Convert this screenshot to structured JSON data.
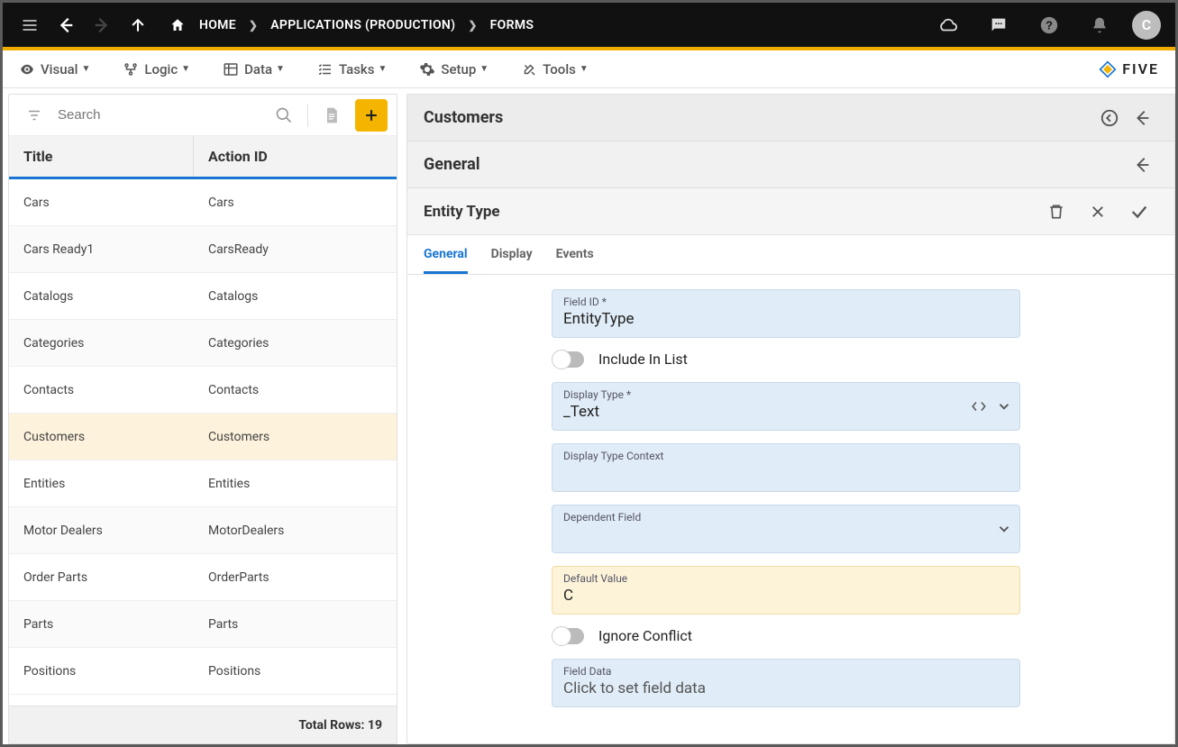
{
  "breadcrumb": {
    "home": "HOME",
    "apps": "APPLICATIONS (PRODUCTION)",
    "forms": "FORMS"
  },
  "avatar_letter": "C",
  "menubar": [
    {
      "id": "visual",
      "label": "Visual"
    },
    {
      "id": "logic",
      "label": "Logic"
    },
    {
      "id": "data",
      "label": "Data"
    },
    {
      "id": "tasks",
      "label": "Tasks"
    },
    {
      "id": "setup",
      "label": "Setup"
    },
    {
      "id": "tools",
      "label": "Tools"
    }
  ],
  "brand": "FIVE",
  "left": {
    "search_placeholder": "Search",
    "columns": {
      "title": "Title",
      "action": "Action ID"
    },
    "rows": [
      {
        "title": "Cars",
        "action": "Cars",
        "selected": false
      },
      {
        "title": "Cars Ready1",
        "action": "CarsReady",
        "selected": false
      },
      {
        "title": "Catalogs",
        "action": "Catalogs",
        "selected": false
      },
      {
        "title": "Categories",
        "action": "Categories",
        "selected": false
      },
      {
        "title": "Contacts",
        "action": "Contacts",
        "selected": false
      },
      {
        "title": "Customers",
        "action": "Customers",
        "selected": true
      },
      {
        "title": "Entities",
        "action": "Entities",
        "selected": false
      },
      {
        "title": "Motor Dealers",
        "action": "MotorDealers",
        "selected": false
      },
      {
        "title": "Order Parts",
        "action": "OrderParts",
        "selected": false
      },
      {
        "title": "Parts",
        "action": "Parts",
        "selected": false
      },
      {
        "title": "Positions",
        "action": "Positions",
        "selected": false
      }
    ],
    "footer": "Total Rows: 19"
  },
  "right": {
    "header1": "Customers",
    "header2": "General",
    "header3": "Entity Type",
    "tabs": [
      {
        "id": "general",
        "label": "General",
        "active": true
      },
      {
        "id": "display",
        "label": "Display",
        "active": false
      },
      {
        "id": "events",
        "label": "Events",
        "active": false
      }
    ],
    "fields": {
      "fieldid_label": "Field ID *",
      "fieldid_value": "EntityType",
      "include_in_list_label": "Include In List",
      "include_in_list_value": false,
      "displaytype_label": "Display Type *",
      "displaytype_value": "_Text",
      "displaytype_context_label": "Display Type Context",
      "displaytype_context_value": "",
      "dependent_label": "Dependent Field",
      "dependent_value": "",
      "default_label": "Default Value",
      "default_value": "C",
      "ignore_conflict_label": "Ignore Conflict",
      "ignore_conflict_value": false,
      "fielddata_label": "Field Data",
      "fielddata_value": "Click to set field data"
    }
  }
}
